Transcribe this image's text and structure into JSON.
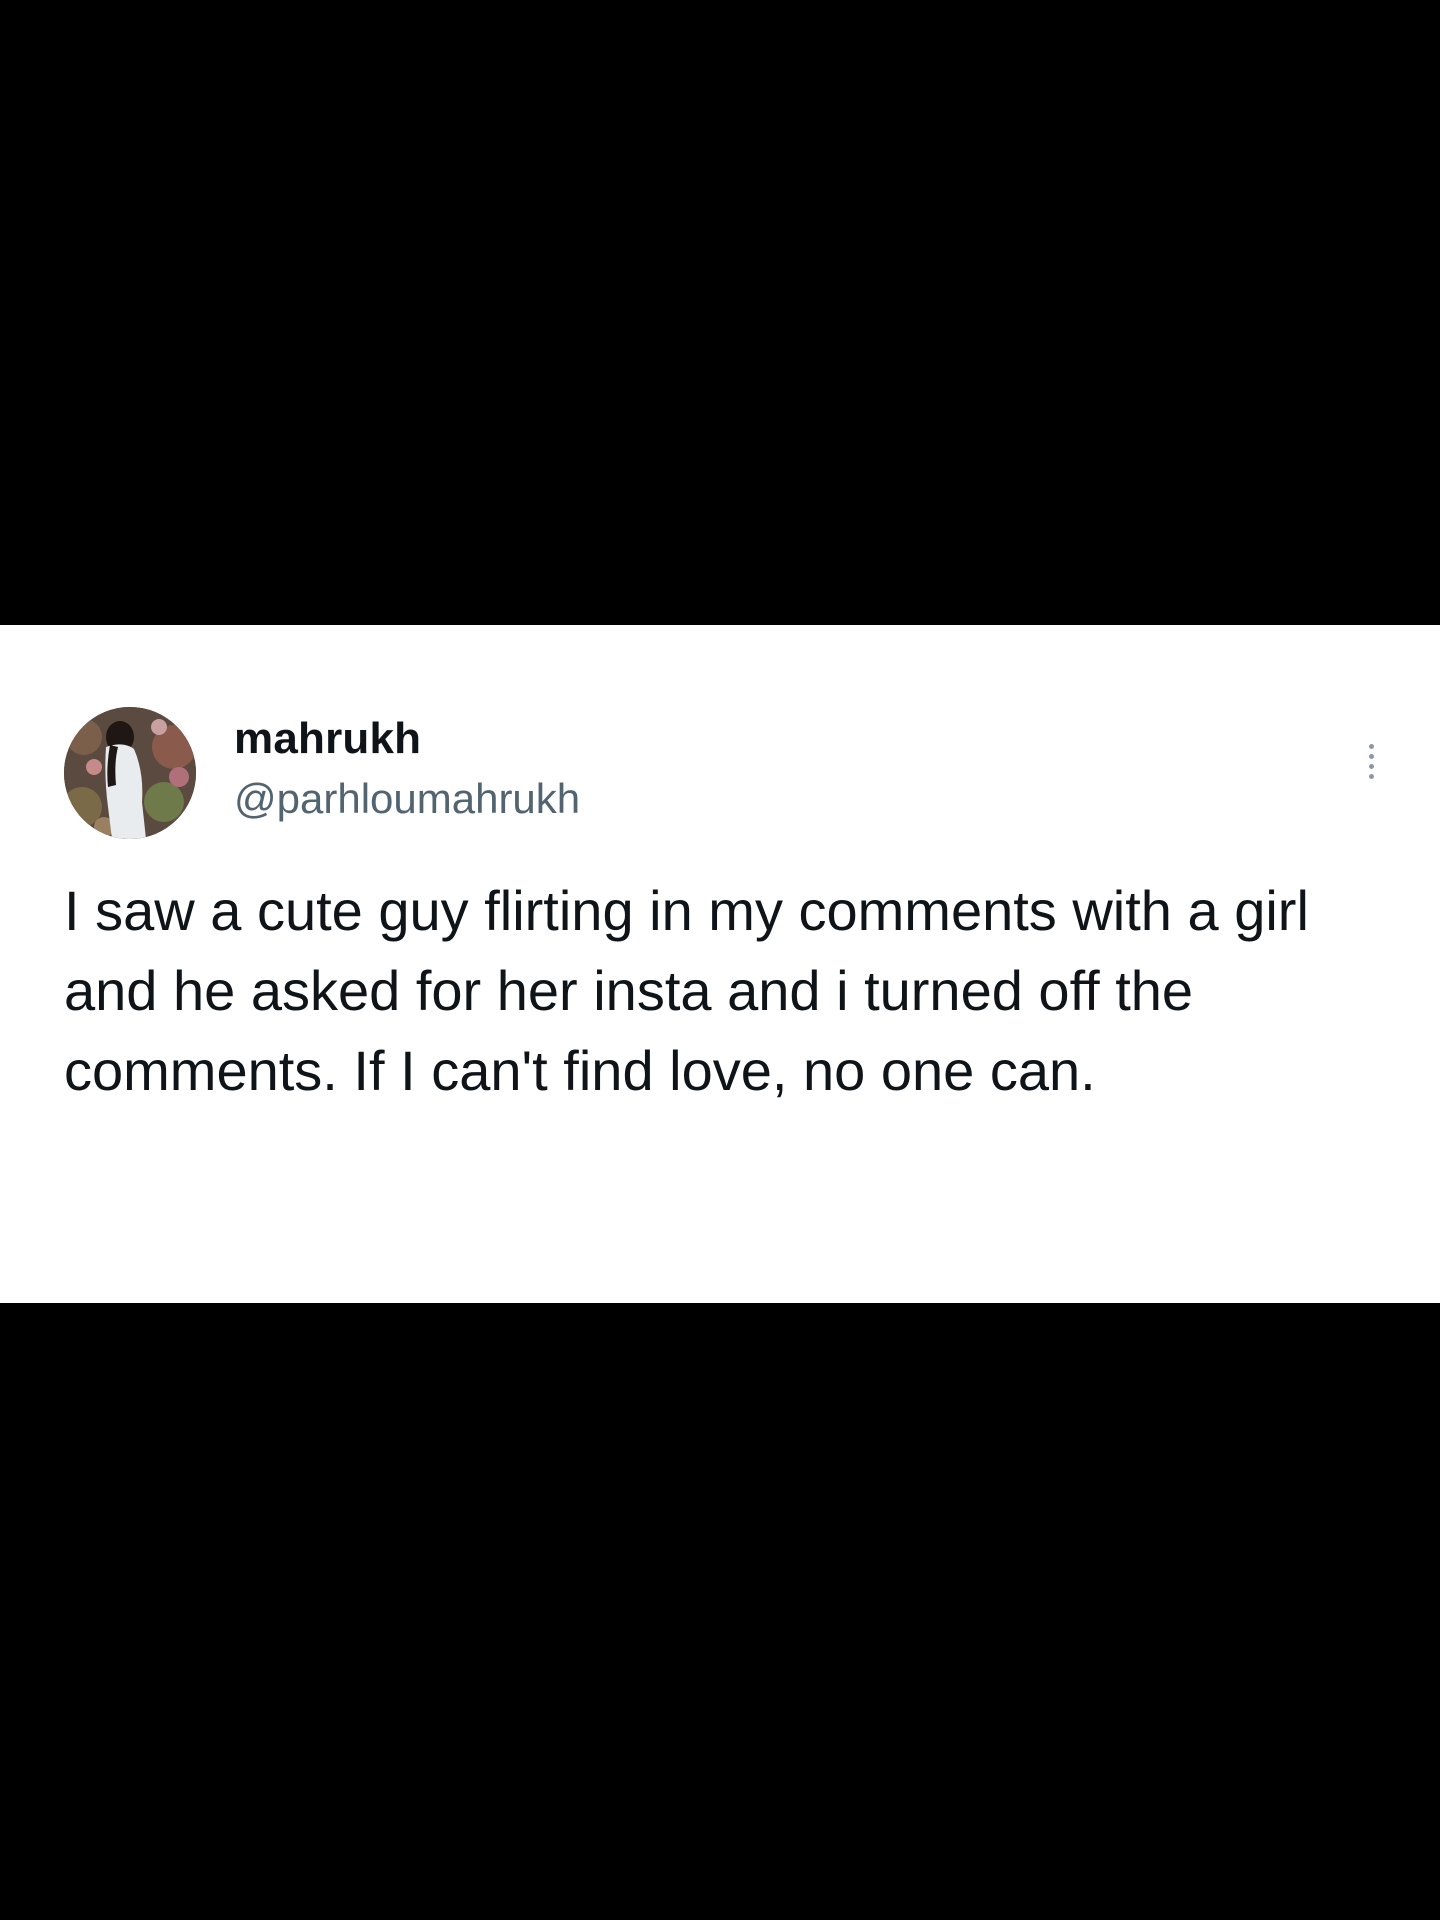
{
  "tweet": {
    "author": {
      "display_name": "mahrukh",
      "handle": "@parhloumahrukh",
      "avatar_icon": "profile-photo-avatar"
    },
    "more_icon": "more-options-vertical-dots-icon",
    "text": "I saw a cute guy flirting in my comments with a girl and he asked for her insta and i turned off the comments. If I can't find love, no one can."
  },
  "colors": {
    "background": "#000000",
    "card": "#ffffff",
    "primary_text": "#0f1419",
    "secondary_text": "#536471"
  }
}
